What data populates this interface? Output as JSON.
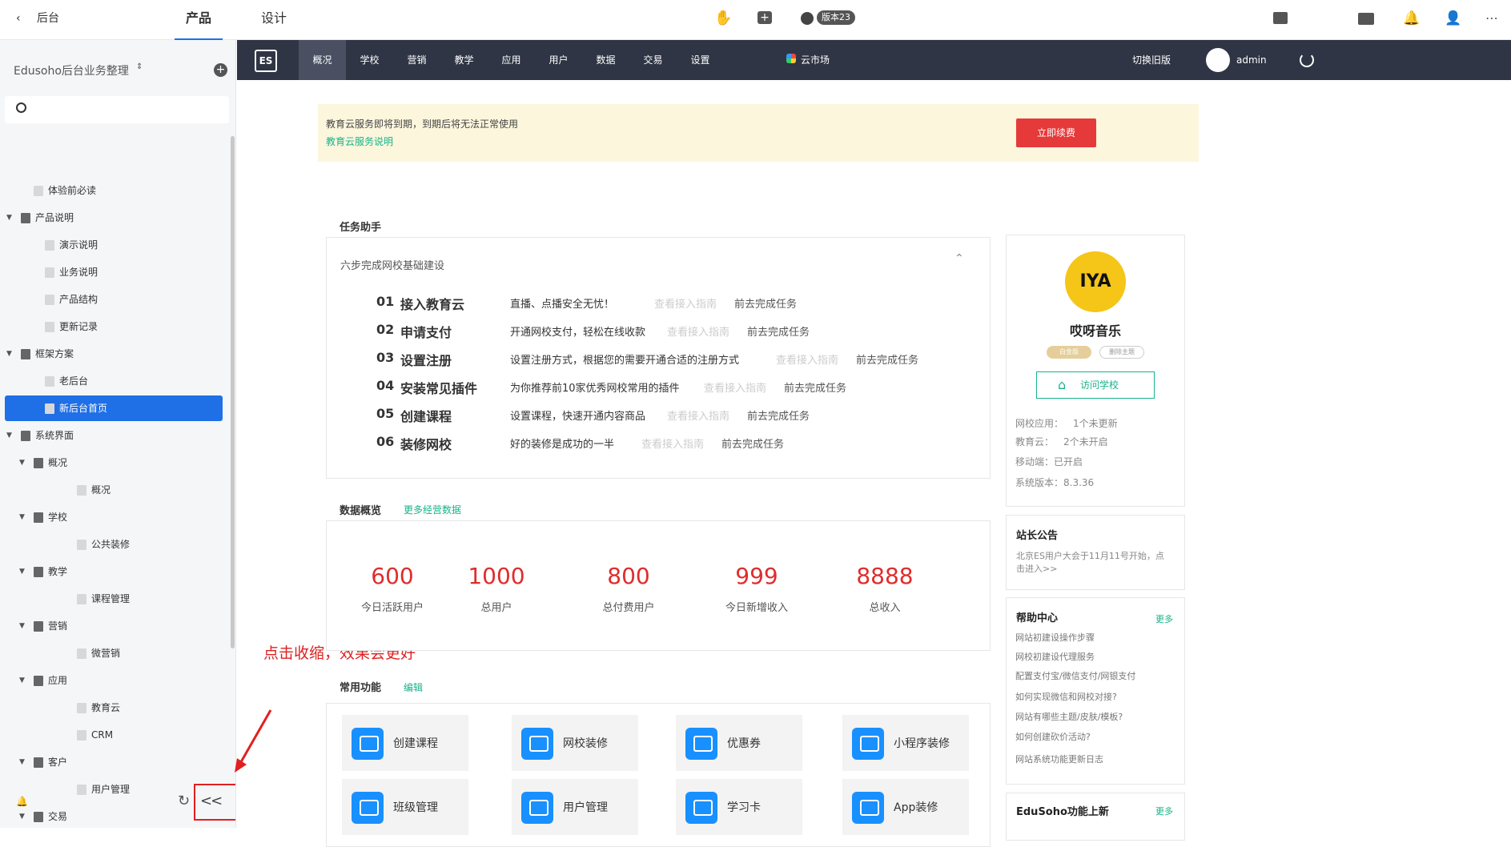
{
  "topbar": {
    "back_label": "后台",
    "tabs": [
      "产品",
      "设计"
    ],
    "version": "版本23"
  },
  "sidebar": {
    "title": "Edusoho后台业务整理",
    "tree": [
      {
        "label": "体验前必读",
        "level": 1,
        "type": "doc"
      },
      {
        "label": "产品说明",
        "level": 0,
        "type": "folder"
      },
      {
        "label": "演示说明",
        "level": 2,
        "type": "doc"
      },
      {
        "label": "业务说明",
        "level": 2,
        "type": "doc"
      },
      {
        "label": "产品结构",
        "level": 2,
        "type": "doc"
      },
      {
        "label": "更新记录",
        "level": 2,
        "type": "doc"
      },
      {
        "label": "框架方案",
        "level": 0,
        "type": "folder"
      },
      {
        "label": "老后台",
        "level": 2,
        "type": "doc"
      },
      {
        "label": "新后台首页",
        "level": 2,
        "type": "doc",
        "active": true
      },
      {
        "label": "系统界面",
        "level": 0,
        "type": "folder"
      },
      {
        "label": "概况",
        "level": 1,
        "type": "folder"
      },
      {
        "label": "概况",
        "level": 3,
        "type": "doc"
      },
      {
        "label": "学校",
        "level": 1,
        "type": "folder"
      },
      {
        "label": "公共装修",
        "level": 3,
        "type": "doc"
      },
      {
        "label": "教学",
        "level": 1,
        "type": "folder"
      },
      {
        "label": "课程管理",
        "level": 3,
        "type": "doc"
      },
      {
        "label": "营销",
        "level": 1,
        "type": "folder"
      },
      {
        "label": "微营销",
        "level": 3,
        "type": "doc"
      },
      {
        "label": "应用",
        "level": 1,
        "type": "folder"
      },
      {
        "label": "教育云",
        "level": 3,
        "type": "doc"
      },
      {
        "label": "CRM",
        "level": 3,
        "type": "doc"
      },
      {
        "label": "客户",
        "level": 1,
        "type": "folder"
      },
      {
        "label": "用户管理",
        "level": 3,
        "type": "doc"
      },
      {
        "label": "交易",
        "level": 1,
        "type": "folder"
      }
    ],
    "collapse_label": "<<"
  },
  "annotation": "点击收缩，效果会更好",
  "nav": {
    "logo": "ES",
    "items": [
      "概况",
      "学校",
      "营销",
      "教学",
      "应用",
      "用户",
      "数据",
      "交易",
      "设置"
    ],
    "cloud_market": "云市场",
    "switch_old": "切换旧版",
    "user": "admin"
  },
  "notice": {
    "text": "教育云服务即将到期，到期后将无法正常使用",
    "link": "教育云服务说明",
    "button": "立即续费"
  },
  "task_assistant": {
    "title": "任务助手",
    "subtitle": "六步完成网校基础建设",
    "tasks": [
      {
        "num": "01",
        "name": "接入教育云",
        "desc": "直播、点播安全无忧！",
        "guide": "查看接入指南",
        "go": "前去完成任务"
      },
      {
        "num": "02",
        "name": "申请支付",
        "desc": "开通网校支付，轻松在线收款",
        "guide": "查看接入指南",
        "go": "前去完成任务"
      },
      {
        "num": "03",
        "name": "设置注册",
        "desc": "设置注册方式，根据您的需要开通合适的注册方式",
        "guide": "查看接入指南",
        "go": "前去完成任务"
      },
      {
        "num": "04",
        "name": "安装常见插件",
        "desc": "为你推荐前10家优秀网校常用的插件",
        "guide": "查看接入指南",
        "go": "前去完成任务"
      },
      {
        "num": "05",
        "name": "创建课程",
        "desc": "设置课程，快速开通内容商品",
        "guide": "查看接入指南",
        "go": "前去完成任务"
      },
      {
        "num": "06",
        "name": "装修网校",
        "desc": "好的装修是成功的一半",
        "guide": "查看接入指南",
        "go": "前去完成任务"
      }
    ]
  },
  "data_overview": {
    "title": "数据概览",
    "more": "更多经营数据",
    "stats": [
      {
        "value": "600",
        "label": "今日活跃用户"
      },
      {
        "value": "1000",
        "label": "总用户"
      },
      {
        "value": "800",
        "label": "总付费用户"
      },
      {
        "value": "999",
        "label": "今日新增收入"
      },
      {
        "value": "8888",
        "label": "总收入"
      }
    ]
  },
  "common_functions": {
    "title": "常用功能",
    "edit": "编辑",
    "items": [
      "创建课程",
      "网校装修",
      "优惠券",
      "小程序装修",
      "班级管理",
      "用户管理",
      "学习卡",
      "App装修"
    ]
  },
  "school_card": {
    "logo_text": "IYA",
    "name": "哎呀音乐",
    "badge1": "白金版",
    "badge2": "删除主题",
    "visit": "访问学校",
    "lines": [
      "网校应用：",
      "1个未更新",
      "教育云：",
      "2个未开启",
      "移动端：已开启",
      "系统版本：8.3.36"
    ]
  },
  "announcement": {
    "title": "站长公告",
    "text1": "北京ES用户大会于11月11号开始，点",
    "text2": "击进入>>"
  },
  "help": {
    "title": "帮助中心",
    "more": "更多",
    "items": [
      "网站初建设操作步骤",
      "网校初建设代理服务",
      "配置支付宝/微信支付/网银支付",
      "如何实现微信和网校对接?",
      "网站有哪些主题/皮肤/模板?",
      "如何创建砍价活动?",
      "网站系统功能更新日志"
    ]
  },
  "updates": {
    "title": "EduSoho功能上新",
    "more": "更多"
  }
}
